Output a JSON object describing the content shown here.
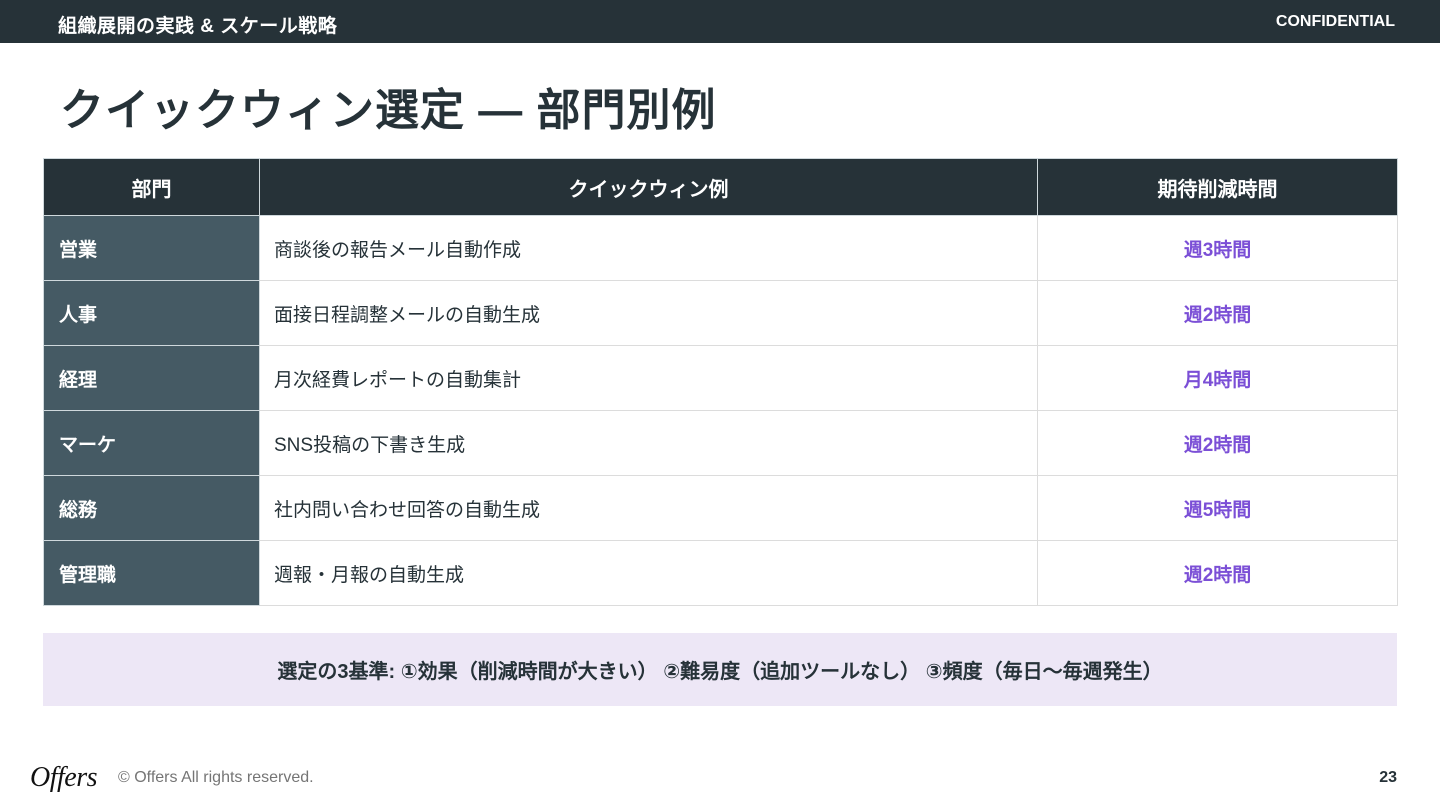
{
  "header": {
    "section_title": "組織展開の実践 & スケール戦略",
    "confidential_label": "CONFIDENTIAL"
  },
  "slide": {
    "title": "クイックウィン選定 — 部門別例"
  },
  "table": {
    "columns": [
      "部門",
      "クイックウィン例",
      "期待削減時間"
    ],
    "rows": [
      {
        "dept": "営業",
        "example": "商談後の報告メール自動作成",
        "saving": "週3時間"
      },
      {
        "dept": "人事",
        "example": "面接日程調整メールの自動生成",
        "saving": "週2時間"
      },
      {
        "dept": "経理",
        "example": "月次経費レポートの自動集計",
        "saving": "月4時間"
      },
      {
        "dept": "マーケ",
        "example": "SNS投稿の下書き生成",
        "saving": "週2時間"
      },
      {
        "dept": "総務",
        "example": "社内問い合わせ回答の自動生成",
        "saving": "週5時間"
      },
      {
        "dept": "管理職",
        "example": "週報・月報の自動生成",
        "saving": "週2時間"
      }
    ]
  },
  "criteria_note": "選定の3基準: ①効果（削減時間が大きい） ②難易度（追加ツールなし） ③頻度（毎日〜毎週発生）",
  "footer": {
    "logo_text": "Offers",
    "copyright": "© Offers All rights reserved.",
    "page_number": "23"
  },
  "colors": {
    "header_bg": "#263238",
    "dept_cell_bg": "#455a64",
    "accent_purple": "#7b4fd6",
    "criteria_bg": "#ede7f6"
  }
}
